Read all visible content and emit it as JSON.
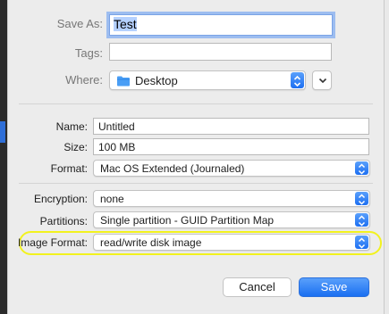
{
  "save_as": {
    "label": "Save As:",
    "value": "Test"
  },
  "tags": {
    "label": "Tags:",
    "value": ""
  },
  "where": {
    "label": "Where:",
    "value": "Desktop"
  },
  "image": {
    "name": {
      "label": "Name:",
      "value": "Untitled"
    },
    "size": {
      "label": "Size:",
      "value": "100 MB"
    },
    "format": {
      "label": "Format:",
      "value": "Mac OS Extended (Journaled)"
    }
  },
  "options": {
    "encryption": {
      "label": "Encryption:",
      "value": "none"
    },
    "partitions": {
      "label": "Partitions:",
      "value": "Single partition - GUID Partition Map"
    },
    "image_format": {
      "label": "Image Format:",
      "value": "read/write disk image"
    }
  },
  "buttons": {
    "cancel": "Cancel",
    "save": "Save"
  },
  "colors": {
    "accent": "#1a6ff1",
    "highlight_ring": "#f2f21e",
    "folder_icon": "#4a9ef5"
  }
}
